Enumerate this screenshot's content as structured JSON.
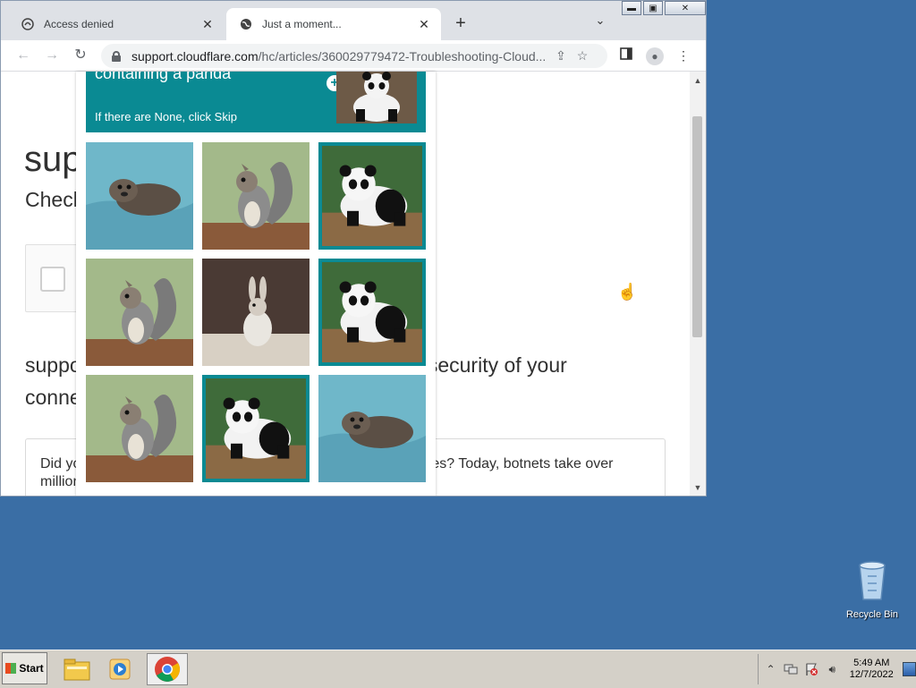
{
  "browser": {
    "tabs": [
      {
        "title": "Access denied",
        "icon": "cloudflare-icon"
      },
      {
        "title": "Just a moment...",
        "icon": "globe-icon"
      }
    ],
    "new_tab_label": "+",
    "window_controls": {
      "minimize": "—",
      "maximize": "☐",
      "close": "✕"
    },
    "url_host": "support.cloudflare.com",
    "url_path": "/hc/articles/360029779472-Troubleshooting-Cloud..."
  },
  "page": {
    "site_title": "sup",
    "checking": "Check",
    "review_line1_start": "suppo",
    "review_line1_end": "e security of your",
    "review_line2": "conne",
    "info_left": "Did yo",
    "info_right": "ces? Today, botnets take over",
    "info_line2": "million"
  },
  "captcha": {
    "prompt": "containing a panda",
    "skip_hint": "If there are None, click Skip",
    "tiles": [
      {
        "subject": "otter",
        "selected": false
      },
      {
        "subject": "squirrel",
        "selected": false
      },
      {
        "subject": "panda",
        "selected": true
      },
      {
        "subject": "squirrel",
        "selected": false
      },
      {
        "subject": "rabbit",
        "selected": false
      },
      {
        "subject": "panda",
        "selected": true
      },
      {
        "subject": "squirrel",
        "selected": false
      },
      {
        "subject": "panda",
        "selected": true
      },
      {
        "subject": "otter",
        "selected": false
      }
    ]
  },
  "desktop": {
    "recycle_bin": "Recycle Bin"
  },
  "taskbar": {
    "start": "Start",
    "time": "5:49 AM",
    "date": "12/7/2022"
  },
  "colors": {
    "accent": "#0a8a93",
    "desktop": "#3a6ea5"
  }
}
